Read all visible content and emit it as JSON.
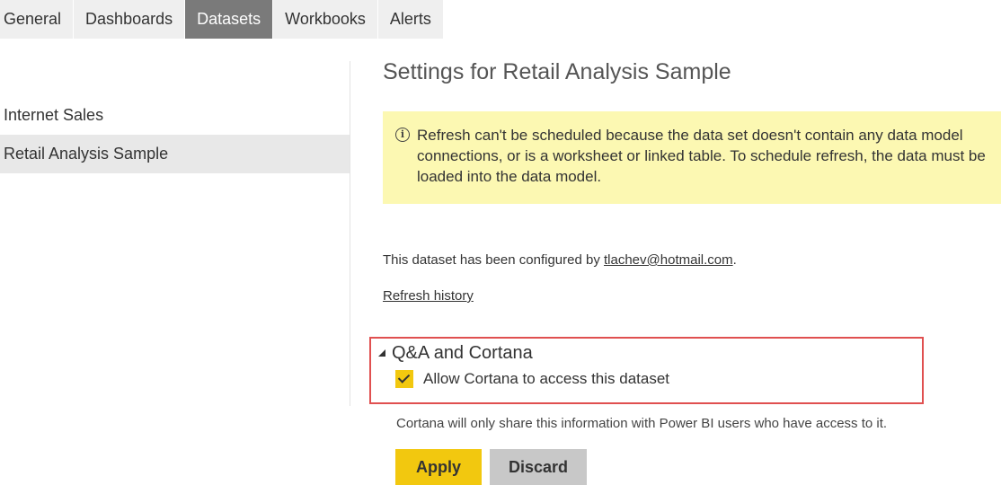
{
  "tabs": [
    {
      "label": "General"
    },
    {
      "label": "Dashboards"
    },
    {
      "label": "Datasets",
      "active": true
    },
    {
      "label": "Workbooks"
    },
    {
      "label": "Alerts"
    }
  ],
  "datasets": [
    {
      "label": "Internet Sales"
    },
    {
      "label": "Retail Analysis Sample",
      "selected": true
    }
  ],
  "settings": {
    "title": "Settings for Retail Analysis Sample",
    "warning": {
      "icon": "info-icon",
      "text": "Refresh can't be scheduled because the data set doesn't contain any data model connections, or is a worksheet or linked table. To schedule refresh, the data must be loaded into the data model."
    },
    "configured_prefix": "This dataset has been configured by ",
    "configured_email": "tlachev@hotmail.com",
    "configured_suffix": ".",
    "refresh_history": "Refresh history",
    "cortana": {
      "section_title": "Q&A and Cortana",
      "checkbox_label": "Allow Cortana to access this dataset",
      "checked": true,
      "note": "Cortana will only share this information with Power BI users who have access to it."
    },
    "buttons": {
      "apply": "Apply",
      "discard": "Discard"
    }
  },
  "colors": {
    "accent": "#f2c80f",
    "active_tab": "#7a7a7a",
    "warning_bg": "#fcf8b2",
    "highlight_border": "#e05050"
  }
}
